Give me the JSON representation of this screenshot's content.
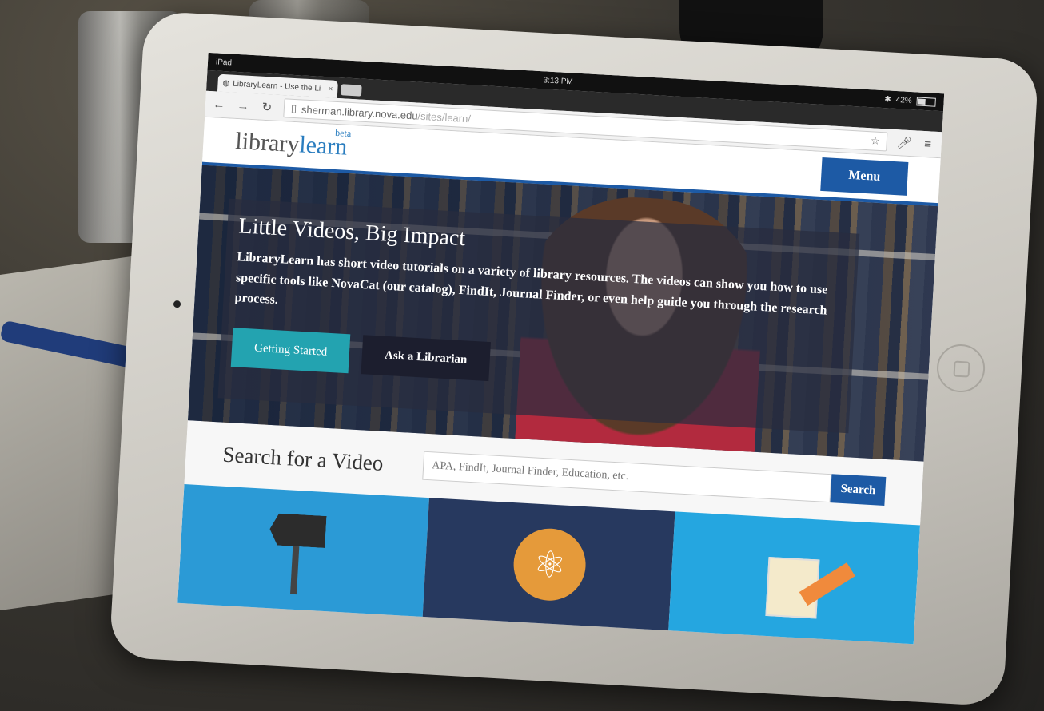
{
  "status": {
    "device": "iPad",
    "time": "3:13 PM",
    "battery": "42%"
  },
  "browser": {
    "tab_title": "LibraryLearn - Use the Li",
    "url_host": "sherman.library.nova.edu",
    "url_path": "/sites/learn/"
  },
  "header": {
    "logo_main": "library",
    "logo_accent": "learn",
    "logo_badge": "beta",
    "menu_label": "Menu"
  },
  "hero": {
    "title": "Little Videos, Big Impact",
    "body": "LibraryLearn has short video tutorials on a variety of library resources. The videos can show you how to use specific tools like NovaCat (our catalog), FindIt, Journal Finder, or even help guide you through the research process.",
    "primary_button": "Getting Started",
    "secondary_button": "Ask a Librarian"
  },
  "search": {
    "heading": "Search for a Video",
    "placeholder": "APA, FindIt, Journal Finder, Education, etc.",
    "button": "Search"
  },
  "tiles": [
    {
      "icon": "signpost-icon"
    },
    {
      "icon": "atom-icon"
    },
    {
      "icon": "notes-pencil-icon"
    }
  ]
}
